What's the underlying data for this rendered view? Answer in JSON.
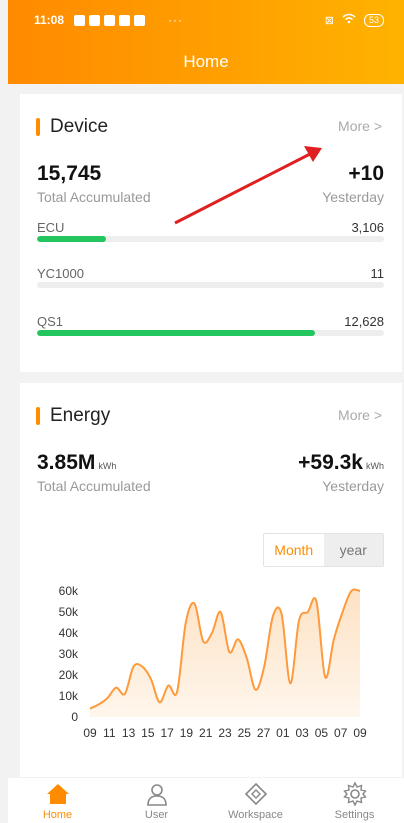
{
  "status_bar": {
    "time": "11:08",
    "dots": "···",
    "battery": "53"
  },
  "header": {
    "title": "Home"
  },
  "device": {
    "title": "Device",
    "more": "More >",
    "total": "15,745",
    "total_label": "Total Accumulated",
    "yesterday": "+10",
    "yesterday_label": "Yesterday",
    "rows": [
      {
        "label": "ECU",
        "value": "3,106",
        "progress_pct": 20
      },
      {
        "label": "YC1000",
        "value": "11",
        "progress_pct": 0
      },
      {
        "label": "QS1",
        "value": "12,628",
        "progress_pct": 80
      }
    ]
  },
  "energy": {
    "title": "Energy",
    "more": "More >",
    "total": "3.85M",
    "total_unit": "kWh",
    "total_label": "Total Accumulated",
    "yesterday": "+59.3k",
    "yesterday_unit": "kWh",
    "yesterday_label": "Yesterday",
    "toggle": {
      "month": "Month",
      "year": "year",
      "selected": "Month"
    }
  },
  "chart_data": {
    "type": "area",
    "x_tick_labels": [
      "09",
      "11",
      "13",
      "15",
      "17",
      "19",
      "21",
      "23",
      "25",
      "27",
      "01",
      "03",
      "05",
      "07",
      "09"
    ],
    "y_tick_labels": [
      "0",
      "10k",
      "20k",
      "30k",
      "40k",
      "50k",
      "60k"
    ],
    "ylim": [
      0,
      60000
    ],
    "x": [
      "09",
      "10",
      "11",
      "12",
      "13",
      "14",
      "15",
      "16",
      "17",
      "18",
      "19",
      "20",
      "21",
      "22",
      "23",
      "24",
      "25",
      "26",
      "27",
      "28",
      "29",
      "30",
      "31",
      "01",
      "02",
      "03",
      "04",
      "05",
      "06",
      "07",
      "08",
      "09"
    ],
    "values": [
      4000,
      6000,
      9000,
      14000,
      11000,
      24000,
      24000,
      18000,
      7000,
      15000,
      12000,
      45000,
      54000,
      36000,
      40000,
      50000,
      31000,
      37000,
      28000,
      13000,
      24000,
      48000,
      49000,
      16000,
      46000,
      50000,
      55000,
      19000,
      37000,
      50000,
      60000,
      60000
    ],
    "fill_color": "#fde2c4",
    "line_color": "#ff9a3c"
  },
  "tabs": [
    {
      "label": "Home",
      "icon": "home-icon",
      "active": true
    },
    {
      "label": "User",
      "icon": "user-icon",
      "active": false
    },
    {
      "label": "Workspace",
      "icon": "workspace-icon",
      "active": false
    },
    {
      "label": "Settings",
      "icon": "gear-icon",
      "active": false
    }
  ],
  "colors": {
    "accent": "#ff8c00",
    "progress": "#22c55e",
    "annotation_arrow": "#e02020"
  }
}
